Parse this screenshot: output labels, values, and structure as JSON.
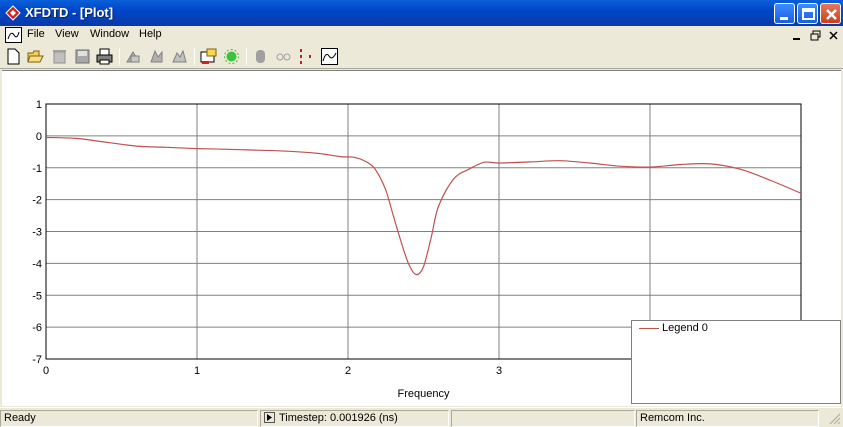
{
  "window": {
    "title": "XFDTD - [Plot]",
    "menu": [
      "File",
      "View",
      "Window",
      "Help"
    ]
  },
  "toolbar": {
    "icons": [
      "new-file-icon",
      "open-folder-icon",
      "delete-icon",
      "save-icon",
      "print-icon",
      "cut-tool-icon",
      "rotate-tool-icon",
      "merge-tool-icon",
      "add-plot-icon",
      "sensor-icon",
      "record-icon",
      "link-icon",
      "points-icon",
      "plot-window-icon"
    ]
  },
  "status": {
    "left": "Ready",
    "timestep": "Timestep: 0.001926 (ns)",
    "middle": "",
    "company": "Remcom Inc."
  },
  "colors": {
    "series": "#c05050",
    "grid": "#808080",
    "titlebar": "#0a5fd8"
  },
  "chart_data": {
    "type": "line",
    "title": "",
    "xlabel": "Frequency",
    "ylabel": "",
    "xlim": [
      0,
      5
    ],
    "ylim": [
      -7,
      1
    ],
    "xticks": [
      "0",
      "1",
      "2",
      "3"
    ],
    "yticks": [
      "1",
      "0",
      "-1",
      "-2",
      "-3",
      "-4",
      "-5",
      "-6",
      "-7"
    ],
    "grid": true,
    "legend": {
      "placement": "bottom-right"
    },
    "series": [
      {
        "name": "Legend 0",
        "x": [
          0,
          0.2,
          0.4,
          0.6,
          0.8,
          1.0,
          1.2,
          1.4,
          1.6,
          1.8,
          1.95,
          2.05,
          2.15,
          2.2,
          2.25,
          2.3,
          2.35,
          2.4,
          2.45,
          2.5,
          2.55,
          2.6,
          2.7,
          2.8,
          2.9,
          3.0,
          3.2,
          3.4,
          3.6,
          3.8,
          4.0,
          4.2,
          4.4,
          4.6,
          4.8,
          5.0
        ],
        "y": [
          -0.05,
          -0.08,
          -0.2,
          -0.32,
          -0.36,
          -0.4,
          -0.42,
          -0.45,
          -0.48,
          -0.55,
          -0.65,
          -0.68,
          -0.9,
          -1.2,
          -1.7,
          -2.5,
          -3.3,
          -4.0,
          -4.35,
          -4.1,
          -3.2,
          -2.2,
          -1.35,
          -1.05,
          -0.83,
          -0.85,
          -0.82,
          -0.78,
          -0.85,
          -0.95,
          -0.98,
          -0.9,
          -0.88,
          -1.05,
          -1.4,
          -1.8
        ]
      }
    ]
  }
}
